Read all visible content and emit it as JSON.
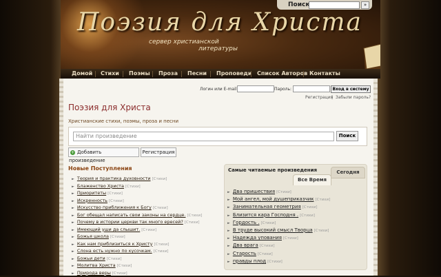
{
  "top_search": {
    "label": "Поиск:",
    "go": "»"
  },
  "logo": {
    "title": "Поэзия для Христа",
    "subtitle_line1": "сервер христианской",
    "subtitle_line2": "литературы"
  },
  "nav": [
    "Домой",
    "Стихи",
    "Поэмы",
    "Проза",
    "Песни",
    "Проповеди",
    "Список Авторов",
    "Контакты"
  ],
  "login": {
    "email_label": "Логин или E-mail:",
    "password_label": "Пароль:",
    "button": "Вход в систему",
    "register": "Регистрация",
    "forgot": "Забыли пароль?",
    "sep": "|"
  },
  "page": {
    "title": "Поэзия для Христа",
    "tagline": "Христианские стихи, поэмы, проза и песни"
  },
  "search": {
    "placeholder": "Найти произведение",
    "button": "Поиск"
  },
  "actions": {
    "add": "Добавить произведение",
    "register": "Регистрация"
  },
  "new_posts": {
    "title": "Новые Поступления",
    "items": [
      {
        "title": "Теория и практика духовности",
        "cat": "[Стихи]"
      },
      {
        "title": "Блаженство Христа",
        "cat": "[Стихи]"
      },
      {
        "title": "Приоритеты",
        "cat": "[Стихи]"
      },
      {
        "title": "Искренность",
        "cat": "[Стихи]"
      },
      {
        "title": "Искусство приближения к Богу",
        "cat": "[Стихи]"
      },
      {
        "title": "Бог обещал написать свои законы на сердце.",
        "cat": "[Стихи]"
      },
      {
        "title": "Почему в истории церкви так много ересей?",
        "cat": "[Стихи]"
      },
      {
        "title": "Имеющий уши да слышит.",
        "cat": "[Стихи]"
      },
      {
        "title": "Божья школа",
        "cat": "[Стихи]"
      },
      {
        "title": "Как нам приблизиться к Христу",
        "cat": "[Стихи]"
      },
      {
        "title": "Слона есть нужно по кусочкам.",
        "cat": "[Стихи]"
      },
      {
        "title": "Божьи дети",
        "cat": "[Стихи]"
      },
      {
        "title": "Молитва Христа",
        "cat": "[Стихи]"
      },
      {
        "title": "Природа веры",
        "cat": "[Стихи]"
      }
    ]
  },
  "popular": {
    "title": "Самые читаемые произведения",
    "tab_today": "Сегодня",
    "tab_all": "Все Время",
    "items": [
      {
        "title": "Два пришествия",
        "cat": "[Стихи]"
      },
      {
        "title": "Мой ангел, мой душеприказчик",
        "cat": "[Стихи]"
      },
      {
        "title": "Занимательная геометрия",
        "cat": "[Стихи]"
      },
      {
        "title": "Близится кара Господня .",
        "cat": "[Стихи]"
      },
      {
        "title": "Гордость .",
        "cat": "[Стихи]"
      },
      {
        "title": "В труде высокий смысл Творца",
        "cat": "[Стихи]"
      },
      {
        "title": "Надежда упования",
        "cat": "[Стихи]"
      },
      {
        "title": "Два врага",
        "cat": "[Стихи]"
      },
      {
        "title": "Старость",
        "cat": "[Стихи]"
      },
      {
        "title": "правды плод",
        "cat": "[Стихи]"
      }
    ]
  }
}
